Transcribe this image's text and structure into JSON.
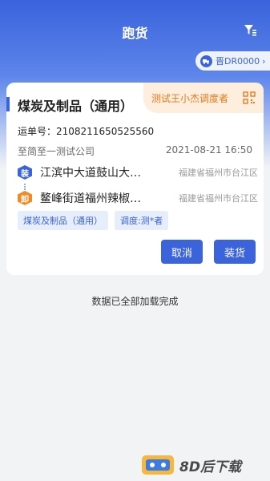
{
  "header": {
    "title": "跑货"
  },
  "plate": {
    "label": "晋DR0000",
    "chevron": "›"
  },
  "card": {
    "title": "煤炭及制品（通用）",
    "dispatcher": "测试王小杰调度者",
    "waybill": "运单号：2108211650525560",
    "company": "至简至一测试公司",
    "datetime": "2021-08-21 16:50",
    "routes": [
      {
        "badge": "装",
        "address": "江滨中大道鼓山大…",
        "area": "福建省福州市台江区"
      },
      {
        "badge": "卸",
        "address": "鳌峰街道福州辣椒…",
        "area": "福建省福州市台江区"
      }
    ],
    "tags": [
      "煤炭及制品（通用）",
      "调度:测*者"
    ],
    "cancel_label": "取消",
    "load_label": "装货"
  },
  "footer": {
    "status": "数据已全部加载完成"
  },
  "watermark": {
    "text": "8D后下载"
  },
  "colors": {
    "primary": "#3a63dc",
    "accent_orange": "#e77a1e",
    "background": "#f2f3f5"
  }
}
